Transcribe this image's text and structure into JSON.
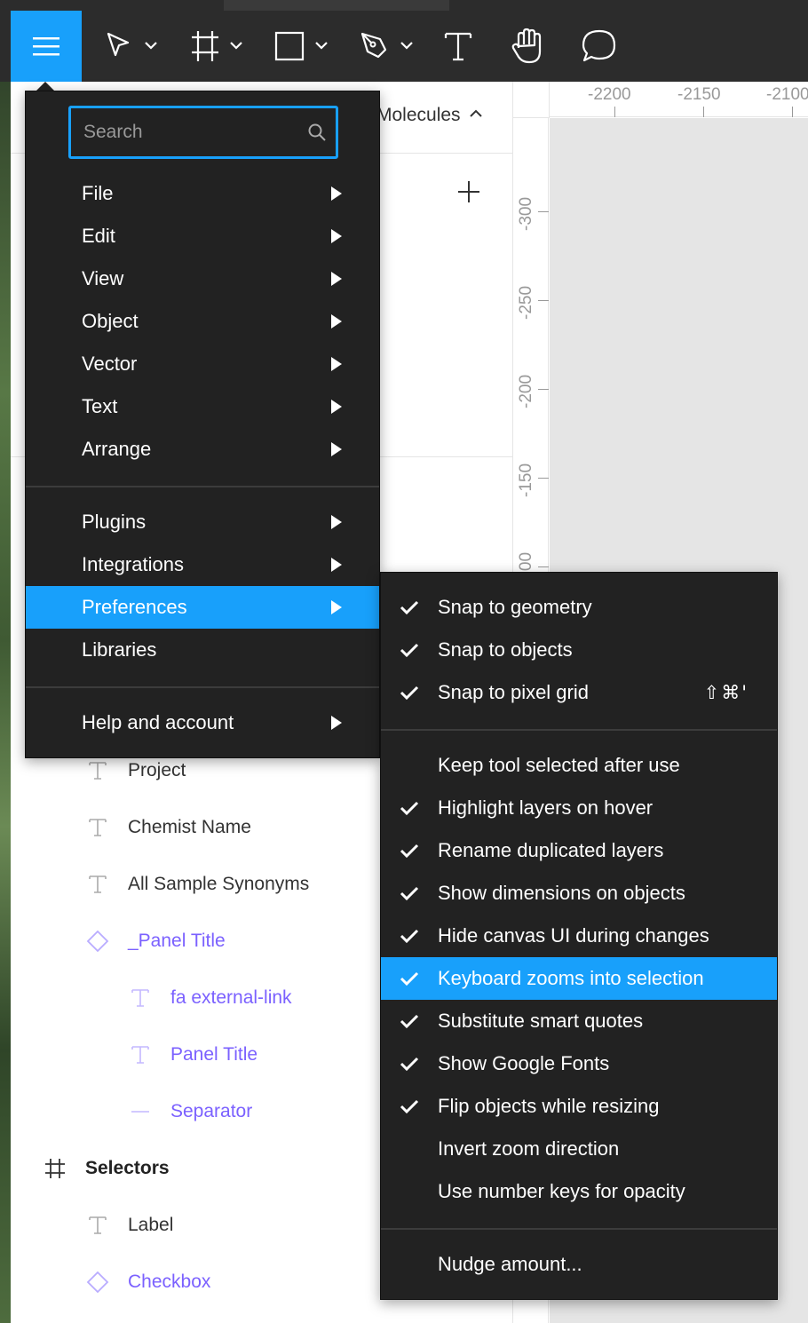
{
  "toolbar": {
    "tools": [
      {
        "name": "main-menu",
        "icon": "hamburger-icon"
      },
      {
        "name": "move-tool",
        "icon": "cursor-icon"
      },
      {
        "name": "frame-tool",
        "icon": "frame-icon"
      },
      {
        "name": "shape-tool",
        "icon": "rectangle-icon"
      },
      {
        "name": "pen-tool",
        "icon": "pen-icon"
      },
      {
        "name": "text-tool",
        "icon": "text-icon"
      },
      {
        "name": "hand-tool",
        "icon": "hand-icon"
      },
      {
        "name": "comment-tool",
        "icon": "comment-icon"
      }
    ],
    "accent": "#18a0fb"
  },
  "layers_panel": {
    "page_title": "Molecules",
    "items": [
      {
        "label": "Project",
        "type": "text"
      },
      {
        "label": "Chemist Name",
        "type": "text"
      },
      {
        "label": "All Sample Synonyms",
        "type": "text"
      },
      {
        "label": "_Panel Title",
        "type": "component"
      },
      {
        "label": "fa external-link",
        "type": "text-in-component"
      },
      {
        "label": "Panel Title",
        "type": "text-in-component"
      },
      {
        "label": "Separator",
        "type": "line-in-component"
      },
      {
        "label": "Selectors",
        "type": "frame"
      },
      {
        "label": "Label",
        "type": "text"
      },
      {
        "label": "Checkbox",
        "type": "component"
      }
    ]
  },
  "rulers": {
    "top": [
      "-2200",
      "-2150",
      "-2100"
    ],
    "left": [
      "-300",
      "-250",
      "-200",
      "-150",
      "-100"
    ]
  },
  "main_menu": {
    "search_placeholder": "Search",
    "items": [
      {
        "label": "File",
        "submenu": true
      },
      {
        "label": "Edit",
        "submenu": true
      },
      {
        "label": "View",
        "submenu": true
      },
      {
        "label": "Object",
        "submenu": true
      },
      {
        "label": "Vector",
        "submenu": true
      },
      {
        "label": "Text",
        "submenu": true
      },
      {
        "label": "Arrange",
        "submenu": true
      },
      {
        "label": "Plugins",
        "submenu": true
      },
      {
        "label": "Integrations",
        "submenu": true
      },
      {
        "label": "Preferences",
        "submenu": true,
        "active": true
      },
      {
        "label": "Libraries",
        "submenu": false
      },
      {
        "label": "Help and account",
        "submenu": true
      }
    ]
  },
  "preferences_menu": {
    "items": [
      {
        "label": "Snap to geometry",
        "checked": true
      },
      {
        "label": "Snap to objects",
        "checked": true
      },
      {
        "label": "Snap to pixel grid",
        "checked": true,
        "shortcut": "⇧⌘'"
      },
      {
        "label": "Keep tool selected after use",
        "checked": false
      },
      {
        "label": "Highlight layers on hover",
        "checked": true
      },
      {
        "label": "Rename duplicated layers",
        "checked": true
      },
      {
        "label": "Show dimensions on objects",
        "checked": true
      },
      {
        "label": "Hide canvas UI during changes",
        "checked": true
      },
      {
        "label": "Keyboard zooms into selection",
        "checked": true,
        "active": true
      },
      {
        "label": "Substitute smart quotes",
        "checked": true
      },
      {
        "label": "Show Google Fonts",
        "checked": true
      },
      {
        "label": "Flip objects while resizing",
        "checked": true
      },
      {
        "label": "Invert zoom direction",
        "checked": false
      },
      {
        "label": "Use number keys for opacity",
        "checked": false
      },
      {
        "label": "Nudge amount...",
        "checked": false
      }
    ]
  }
}
